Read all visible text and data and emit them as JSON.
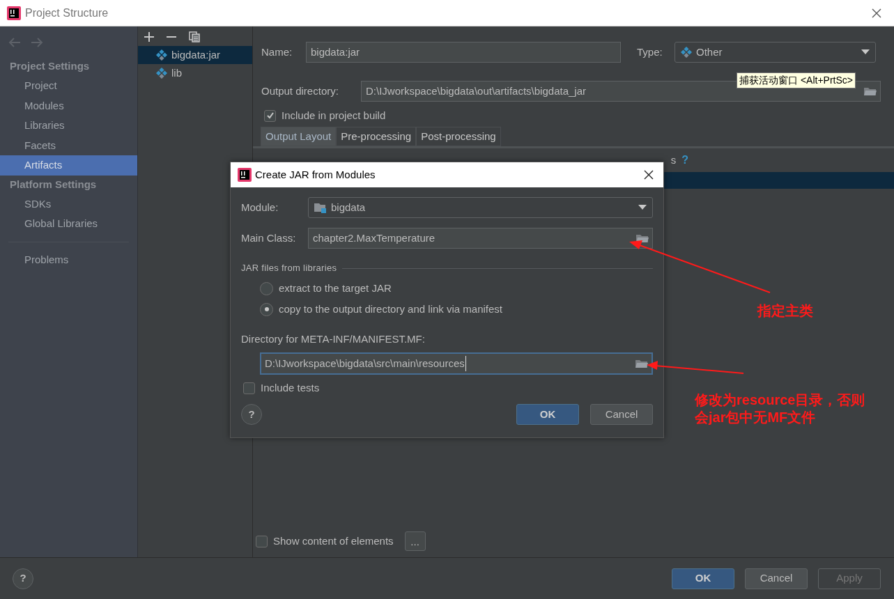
{
  "window": {
    "title": "Project Structure"
  },
  "sidebar": {
    "sections": [
      {
        "heading": "Project Settings",
        "items": [
          {
            "label": "Project",
            "selected": false
          },
          {
            "label": "Modules",
            "selected": false
          },
          {
            "label": "Libraries",
            "selected": false
          },
          {
            "label": "Facets",
            "selected": false
          },
          {
            "label": "Artifacts",
            "selected": true
          }
        ]
      },
      {
        "heading": "Platform Settings",
        "items": [
          {
            "label": "SDKs",
            "selected": false
          },
          {
            "label": "Global Libraries",
            "selected": false
          }
        ]
      }
    ],
    "extra_items": [
      {
        "label": "Problems",
        "selected": false
      }
    ]
  },
  "artifacts": [
    {
      "label": "bigdata:jar",
      "selected": true
    },
    {
      "label": "lib",
      "selected": false
    }
  ],
  "artifact_form": {
    "name_label": "Name:",
    "name": "bigdata:jar",
    "type_label": "Type:",
    "type": "Other",
    "output_label": "Output directory:",
    "output": "D:\\IJworkspace\\bigdata\\out\\artifacts\\bigdata_jar",
    "include_build": {
      "label": "Include in project build",
      "checked": true
    },
    "tabs": [
      {
        "label": "Output Layout",
        "selected": true
      },
      {
        "label": "Pre-processing",
        "selected": false
      },
      {
        "label": "Post-processing",
        "selected": false
      }
    ],
    "layout_fragment": "s",
    "layout_help": "?",
    "layout_row_selected": true,
    "show_content": {
      "label": "Show content of elements",
      "checked": false
    },
    "more_button": "..."
  },
  "tooltip": "捕获活动窗口 <Alt+PrtSc>",
  "dialog": {
    "title": "Create JAR from Modules",
    "module_label": "Module:",
    "module": "bigdata",
    "main_class_label": "Main Class:",
    "main_class": "chapter2.MaxTemperature",
    "libraries_heading": "JAR files from libraries",
    "options": [
      {
        "label": "extract to the target JAR",
        "selected": false
      },
      {
        "label": "copy to the output directory and link via manifest",
        "selected": true
      }
    ],
    "manifest_label": "Directory for META-INF/MANIFEST.MF:",
    "manifest_dir": "D:\\IJworkspace\\bigdata\\src\\main\\resources",
    "include_tests": {
      "label": "Include tests",
      "checked": false
    },
    "help": "?",
    "buttons": [
      {
        "label": "OK",
        "kind": "primary"
      },
      {
        "label": "Cancel",
        "kind": "normal"
      }
    ]
  },
  "annotations": [
    {
      "text": "指定主类"
    },
    {
      "text": "修改为resource目录，否则会jar包中无MF文件"
    }
  ],
  "footer": {
    "help": "?",
    "buttons": [
      {
        "label": "OK",
        "kind": "primary",
        "disabled": false
      },
      {
        "label": "Cancel",
        "kind": "normal",
        "disabled": false
      },
      {
        "label": "Apply",
        "kind": "normal",
        "disabled": true
      }
    ]
  }
}
